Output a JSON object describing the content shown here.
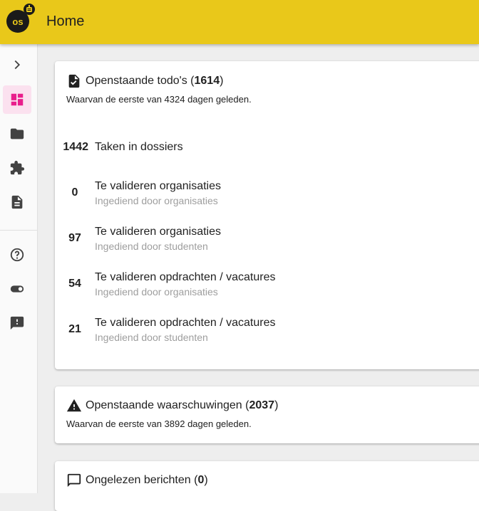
{
  "app": {
    "logo_text": "os",
    "page_title": "Home"
  },
  "sidebar": {
    "items": [
      {
        "name": "expand",
        "icon": "chevron-right-icon"
      },
      {
        "name": "dashboard",
        "icon": "dashboard-icon",
        "active": true
      },
      {
        "name": "folder",
        "icon": "folder-icon"
      },
      {
        "name": "extensions",
        "icon": "puzzle-icon"
      },
      {
        "name": "documents",
        "icon": "document-icon"
      },
      {
        "name": "help",
        "icon": "help-circle-icon"
      },
      {
        "name": "toggle",
        "icon": "toggle-icon"
      },
      {
        "name": "feedback",
        "icon": "feedback-icon"
      }
    ],
    "active_color": "#e91e8c"
  },
  "todos": {
    "title_prefix": "Openstaande todo's (",
    "count": "1614",
    "title_suffix": ")",
    "subtitle": "Waarvan de eerste van 4324 dagen geleden.",
    "rows": [
      {
        "count": "1442",
        "label": "Taken in dossiers",
        "sub": ""
      },
      {
        "count": "0",
        "label": "Te valideren organisaties",
        "sub": "Ingediend door organisaties"
      },
      {
        "count": "97",
        "label": "Te valideren organisaties",
        "sub": "Ingediend door studenten"
      },
      {
        "count": "54",
        "label": "Te valideren opdrachten / vacatures",
        "sub": "Ingediend door organisaties"
      },
      {
        "count": "21",
        "label": "Te valideren opdrachten / vacatures",
        "sub": "Ingediend door studenten"
      }
    ]
  },
  "warnings": {
    "title_prefix": "Openstaande waarschuwingen (",
    "count": "2037",
    "title_suffix": ")",
    "subtitle": "Waarvan de eerste van 3892 dagen geleden."
  },
  "messages": {
    "title_prefix": "Ongelezen berichten (",
    "count": "0",
    "title_suffix": ")"
  },
  "colors": {
    "topbar": "#e9c81a",
    "background": "#eeeeee",
    "icon": "#424242"
  }
}
